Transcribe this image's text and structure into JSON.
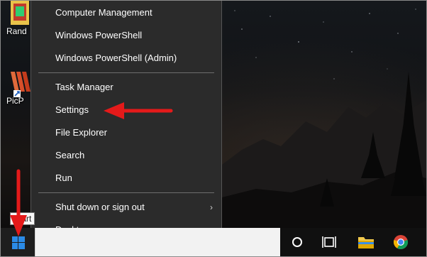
{
  "desktop": {
    "icons": [
      {
        "label": "Rand"
      },
      {
        "label": "PicP"
      }
    ]
  },
  "menu": {
    "items": [
      {
        "label": "Computer Management"
      },
      {
        "label": "Windows PowerShell"
      },
      {
        "label": "Windows PowerShell (Admin)"
      },
      {
        "label": "Task Manager"
      },
      {
        "label": "Settings"
      },
      {
        "label": "File Explorer"
      },
      {
        "label": "Search"
      },
      {
        "label": "Run"
      },
      {
        "label": "Shut down or sign out"
      },
      {
        "label": "Desktop"
      }
    ],
    "submenu_chevron": "›"
  },
  "taskbar": {
    "start_tooltip": "Start"
  },
  "colors": {
    "annotation_red": "#e41a1a",
    "menu_bg": "#2b2b2b",
    "accent_blue": "#2b8be6"
  }
}
